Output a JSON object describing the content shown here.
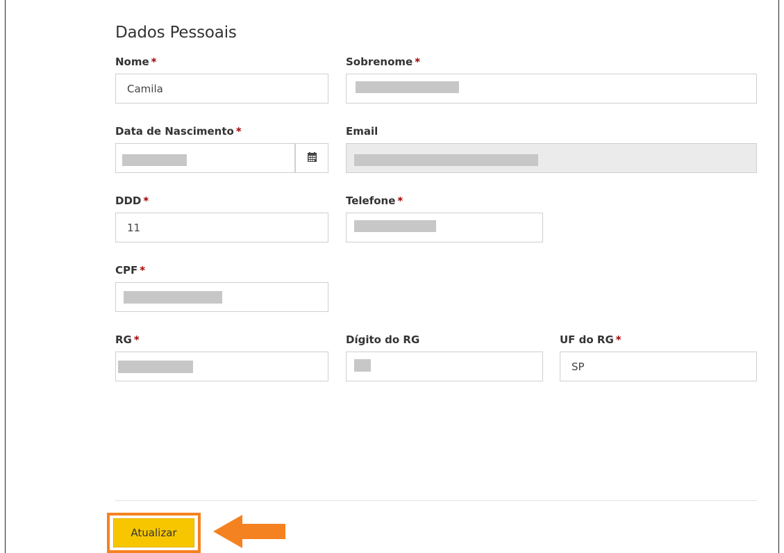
{
  "section_title": "Dados Pessoais",
  "required_mark": "*",
  "fields": {
    "nome": {
      "label": "Nome",
      "value": "Camila"
    },
    "sobrenome": {
      "label": "Sobrenome",
      "value": ""
    },
    "data_nascimento": {
      "label": "Data de Nascimento",
      "value": ""
    },
    "email": {
      "label": "Email",
      "value": ""
    },
    "ddd": {
      "label": "DDD",
      "value": "11"
    },
    "telefone": {
      "label": "Telefone",
      "value": ""
    },
    "cpf": {
      "label": "CPF",
      "value": ""
    },
    "rg": {
      "label": "RG",
      "value": ""
    },
    "digito_rg": {
      "label": "Dígito do RG",
      "value": ""
    },
    "uf_rg": {
      "label": "UF do RG",
      "value": "SP"
    }
  },
  "submit_label": "Atualizar",
  "colors": {
    "button": "#f7c600",
    "highlight": "#f58220",
    "required": "#a10000",
    "redaction": "#c7c7c7"
  },
  "icons": {
    "calendar": "calendar-icon",
    "annotation_arrow": "arrow-left-icon"
  }
}
